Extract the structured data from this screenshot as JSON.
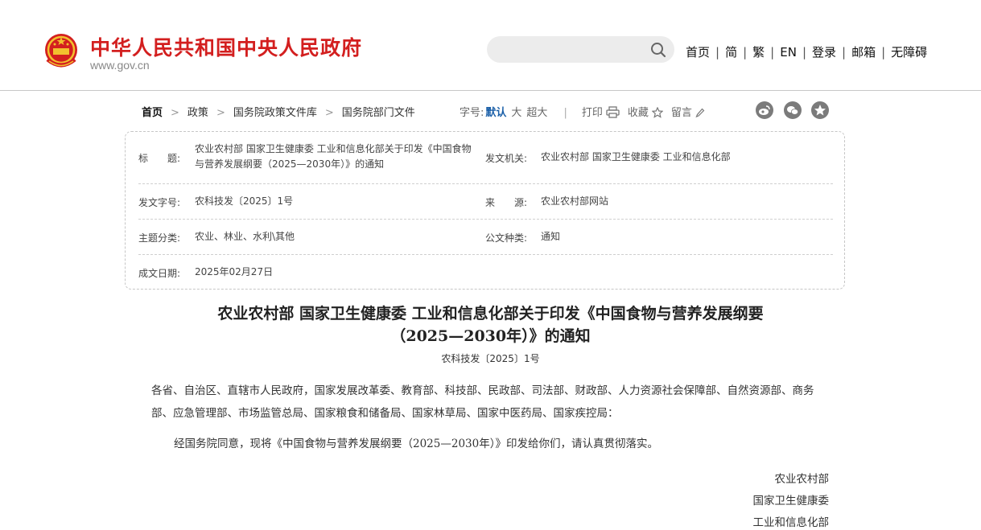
{
  "header": {
    "title": "中华人民共和国中央人民政府",
    "url": "www.gov.cn",
    "nav": [
      "首页",
      "简",
      "繁",
      "EN",
      "登录",
      "邮箱",
      "无障碍"
    ],
    "nav_sep": "|"
  },
  "breadcrumb": {
    "items": [
      "首页",
      "政策",
      "国务院政策文件库",
      "国务院部门文件"
    ],
    "arrow": ">"
  },
  "tools": {
    "font_label": "字号:",
    "font_default": "默认",
    "font_large": "大",
    "font_xlarge": "超大",
    "sep": "|",
    "print": "打印",
    "favorite": "收藏",
    "comment": "留言"
  },
  "meta": {
    "title_label": "标　　题:",
    "title_value": "农业农村部 国家卫生健康委 工业和信息化部关于印发《中国食物与营养发展纲要（2025—2030年）》的通知",
    "issuer_label": "发文机关:",
    "issuer_value": "农业农村部 国家卫生健康委 工业和信息化部",
    "docno_label": "发文字号:",
    "docno_value": "农科技发〔2025〕1号",
    "source_label": "来　　源:",
    "source_value": "农业农村部网站",
    "topic_label": "主题分类:",
    "topic_value": "农业、林业、水利\\其他",
    "type_label": "公文种类:",
    "type_value": "通知",
    "date_label": "成文日期:",
    "date_value": "2025年02月27日"
  },
  "article": {
    "title_line1": "农业农村部 国家卫生健康委 工业和信息化部关于印发《中国食物与营养发展纲要",
    "title_line2": "（2025—2030年）》的通知",
    "doc_no": "农科技发〔2025〕1号",
    "salutation": "各省、自治区、直辖市人民政府，国家发展改革委、教育部、科技部、民政部、司法部、财政部、人力资源社会保障部、自然资源部、商务部、应急管理部、市场监管总局、国家粮食和储备局、国家林草局、国家中医药局、国家疾控局：",
    "paragraph1": "经国务院同意，现将《中国食物与营养发展纲要（2025—2030年）》印发给你们，请认真贯彻落实。",
    "signatures": [
      "农业农村部",
      "国家卫生健康委",
      "工业和信息化部"
    ]
  },
  "colors": {
    "brand_red": "#d31f1f",
    "link_blue": "#1a5fa8"
  }
}
